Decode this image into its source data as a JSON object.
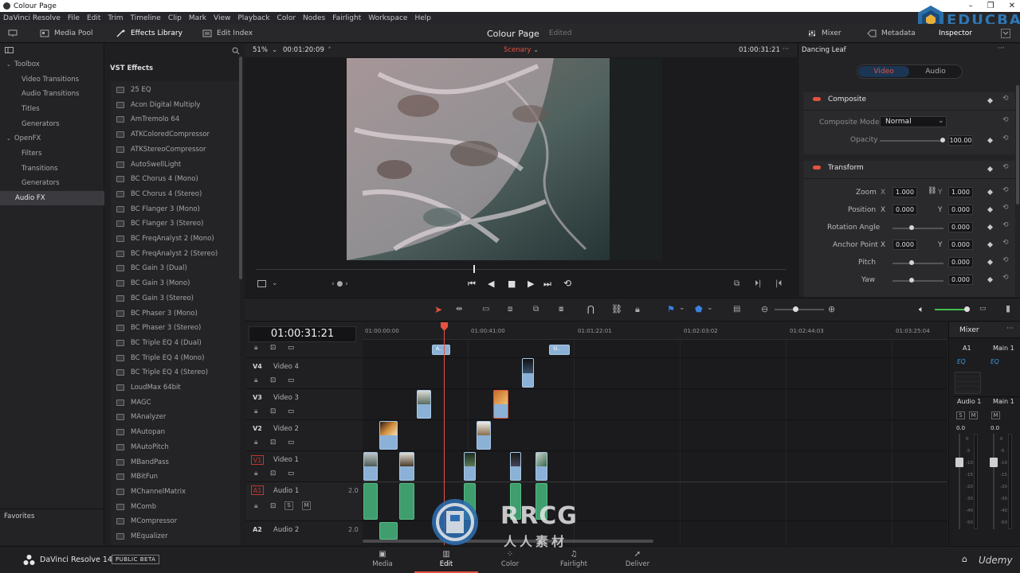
{
  "window": {
    "title": "Colour Page",
    "buttons": [
      "–",
      "❐",
      "✕"
    ]
  },
  "menu": [
    "DaVinci Resolve",
    "File",
    "Edit",
    "Trim",
    "Timeline",
    "Clip",
    "Mark",
    "View",
    "Playback",
    "Color",
    "Nodes",
    "Fairlight",
    "Workspace",
    "Help"
  ],
  "toolbar": {
    "media_pool": "Media Pool",
    "effects_library": "Effects Library",
    "edit_index": "Edit Index",
    "project_title": "Colour Page",
    "project_status": "Edited",
    "mixer": "Mixer",
    "metadata": "Metadata",
    "inspector": "Inspector"
  },
  "brand": {
    "name": "EDUCBA"
  },
  "tree": {
    "items": [
      "Toolbox",
      "Video Transitions",
      "Audio Transitions",
      "Titles",
      "Generators",
      "OpenFX",
      "Filters",
      "Transitions",
      "Generators",
      "Audio FX"
    ],
    "favorites": "Favorites"
  },
  "fx": {
    "header": "VST Effects",
    "items": [
      "25 EQ",
      "Acon Digital Multiply",
      "AmTremolo 64",
      "ATKColoredCompressor",
      "ATKStereoCompressor",
      "AutoSwellLight",
      "BC Chorus 4 (Mono)",
      "BC Chorus 4 (Stereo)",
      "BC Flanger 3 (Mono)",
      "BC Flanger 3 (Stereo)",
      "BC FreqAnalyst 2 (Mono)",
      "BC FreqAnalyst 2 (Stereo)",
      "BC Gain 3 (Dual)",
      "BC Gain 3 (Mono)",
      "BC Gain 3 (Stereo)",
      "BC Phaser 3 (Mono)",
      "BC Phaser 3 (Stereo)",
      "BC Triple EQ 4 (Dual)",
      "BC Triple EQ 4 (Mono)",
      "BC Triple EQ 4 (Stereo)",
      "LoudMax 64bit",
      "MAGC",
      "MAnalyzer",
      "MAutopan",
      "MAutoPitch",
      "MBandPass",
      "MBitFun",
      "MChannelMatrix",
      "MComb",
      "MCompressor",
      "MEqualizer"
    ]
  },
  "viewer": {
    "zoom": "51%",
    "source_timecode": "00:01:20:09",
    "clip_name": "Scenary",
    "record_timecode": "01:00:31:21",
    "more": "···",
    "playhead_fraction": 0.41
  },
  "inspector": {
    "clip_name": "Dancing Leaf",
    "tabs": [
      "Video",
      "Audio"
    ],
    "composite": {
      "title": "Composite",
      "mode_label": "Composite Mode",
      "mode_value": "Normal",
      "opacity_label": "Opacity",
      "opacity_value": "100.00"
    },
    "transform": {
      "title": "Transform",
      "zoom_label": "Zoom",
      "zoom_x": "1.000",
      "zoom_y": "1.000",
      "position_label": "Position",
      "position_x": "0.000",
      "position_y": "0.000",
      "rotation_label": "Rotation Angle",
      "rotation_value": "0.000",
      "anchor_label": "Anchor Point",
      "anchor_x": "0.000",
      "anchor_y": "0.000",
      "pitch_label": "Pitch",
      "pitch_value": "0.000",
      "yaw_label": "Yaw",
      "yaw_value": "0.000",
      "x": "X",
      "y": "Y"
    }
  },
  "timeline": {
    "timecode": "01:00:31:21",
    "ruler": [
      "01:00:00:00",
      "01:00:41:00",
      "01:01:22:01",
      "01:02:03:02",
      "01:02:44:03",
      "01:03:25:04"
    ],
    "tracks": [
      {
        "tag": "V4",
        "name": "Video 4"
      },
      {
        "tag": "V3",
        "name": "Video 3"
      },
      {
        "tag": "V2",
        "name": "Video 2"
      },
      {
        "tag": "V1",
        "name": "Video 1"
      },
      {
        "tag": "A1",
        "name": "Audio 1",
        "level": "2.0"
      },
      {
        "tag": "A2",
        "name": "Audio 2",
        "level": "2.0"
      }
    ],
    "clip_labels": {
      "a": "A..",
      "sl": "Sl.."
    },
    "solo": "S",
    "mute": "M"
  },
  "mixer": {
    "title": "Mixer",
    "ch1": "A1",
    "ch2": "Main 1",
    "eq": "EQ",
    "strip1": "Audio 1",
    "strip2": "Main 1",
    "level1": "0.0",
    "level2": "0.0",
    "scale": [
      "0",
      "-5",
      "-10",
      "-15",
      "-20",
      "-30",
      "-40",
      "-50"
    ]
  },
  "bottom": {
    "app_name": "DaVinci Resolve 14",
    "beta": "PUBLIC BETA",
    "pages": [
      "Media",
      "Edit",
      "Color",
      "Fairlight",
      "Deliver"
    ],
    "active_page": "Edit"
  },
  "watermark": {
    "text": "RRCG",
    "sub": "人人素材"
  },
  "udemy": "Udemy",
  "colors": {
    "accent": "#e5523f",
    "clip": "#8bb1d6",
    "audio_clip": "#3f9d6e",
    "tab_active": "#1b3552"
  }
}
